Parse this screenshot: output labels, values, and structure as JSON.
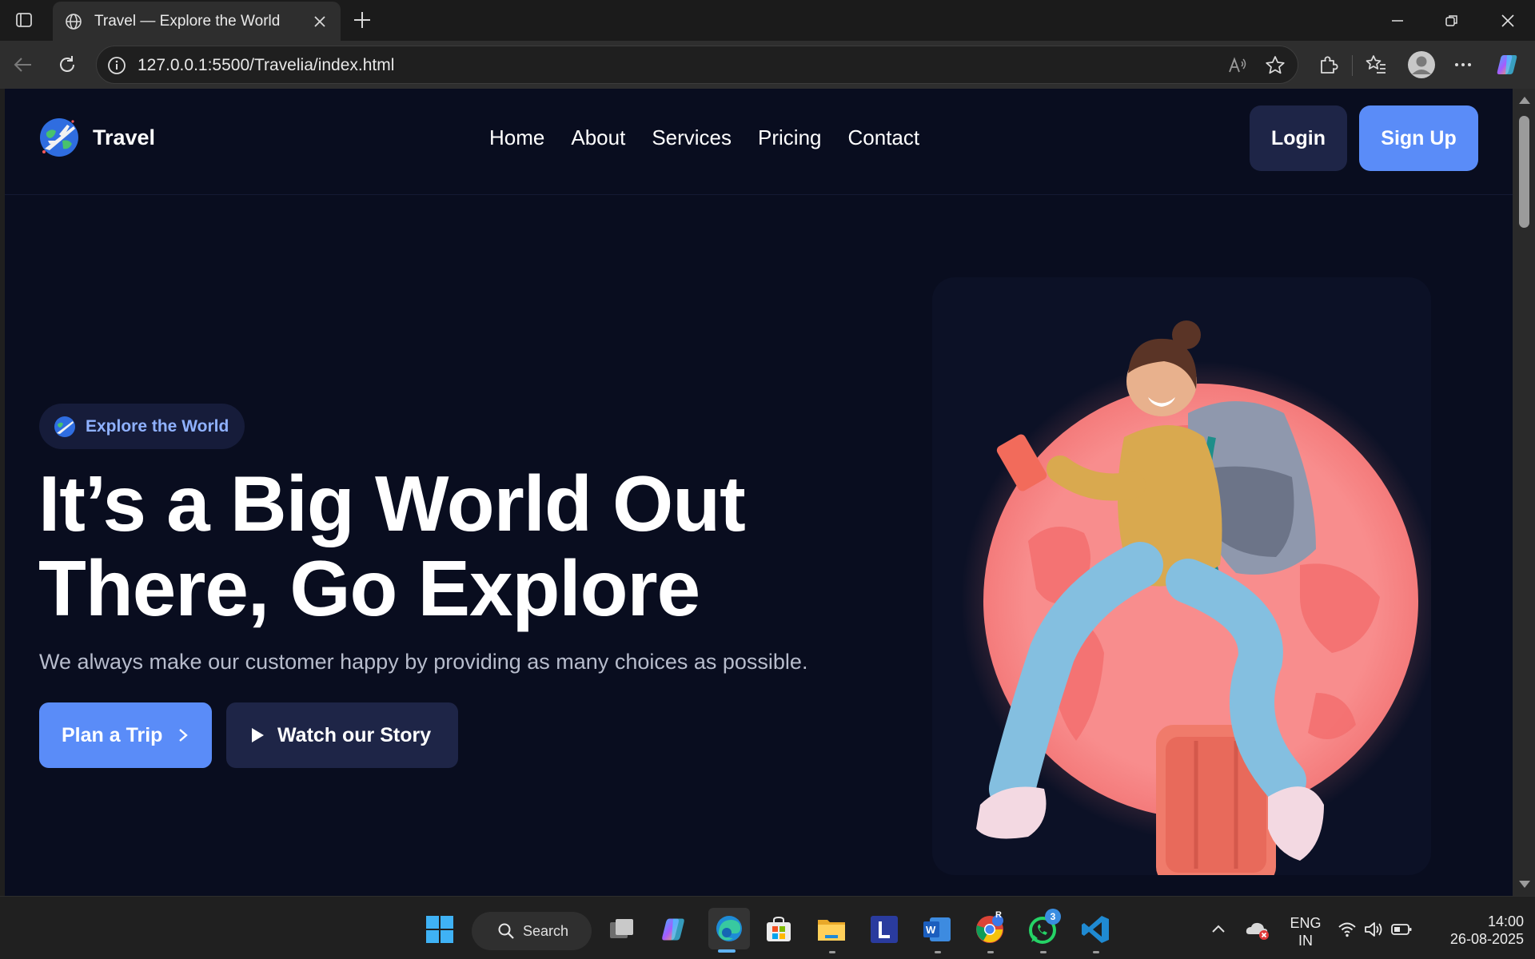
{
  "browser": {
    "tab_title": "Travel — Explore the World",
    "url": "127.0.0.1:5500/Travelia/index.html"
  },
  "site": {
    "brand": "Travel",
    "nav": [
      {
        "label": "Home"
      },
      {
        "label": "About"
      },
      {
        "label": "Services"
      },
      {
        "label": "Pricing"
      },
      {
        "label": "Contact"
      }
    ],
    "login_label": "Login",
    "signup_label": "Sign Up"
  },
  "hero": {
    "badge": "Explore the World",
    "title_line1": "It’s a Big World Out",
    "title_line2": "There, Go Explore",
    "subtitle": "We always make our customer happy by providing as many choices as possible.",
    "cta_primary": "Plan a Trip",
    "cta_secondary": "Watch our Story",
    "image_name": "traveler-with-backpack-on-suitcase"
  },
  "taskbar": {
    "search_label": "Search",
    "lang_line1": "ENG",
    "lang_line2": "IN",
    "time": "14:00",
    "date": "26-08-2025",
    "whatsapp_badge": "3",
    "chrome_badge": "R"
  },
  "colors": {
    "page_bg": "#090d1f",
    "accent": "#5a8cf8",
    "dark_button": "#1e2547",
    "badge_text": "#8fb1ff",
    "globe_pink": "#f88d8d"
  }
}
